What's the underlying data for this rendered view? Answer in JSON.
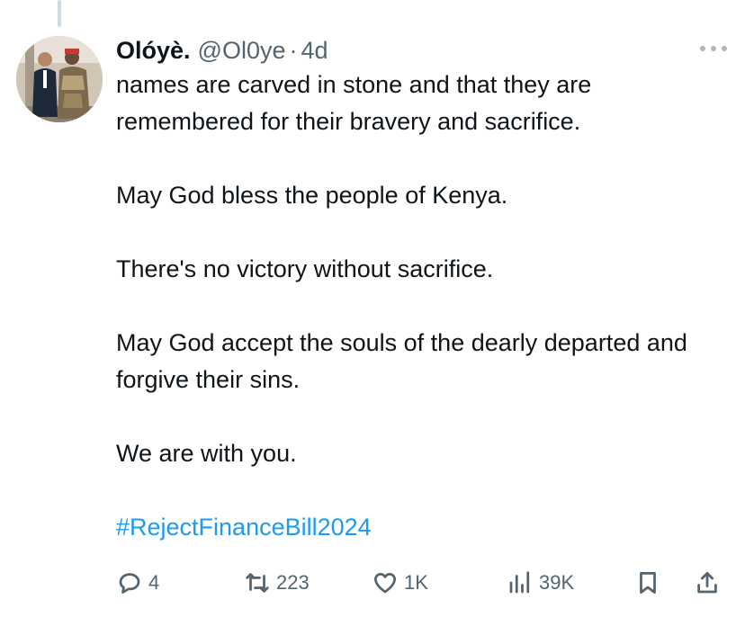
{
  "tweet": {
    "author_name": "Olóyè.",
    "handle": "@Ol0ye",
    "separator": "·",
    "time": "4d",
    "paragraphs": [
      "names are carved in stone and that they are remembered for their bravery and sacrifice.",
      "May God bless the people of Kenya.",
      "There's no victory without sacrifice.",
      "May God accept the souls of the dearly departed and forgive their sins.",
      "We are with you."
    ],
    "hashtag": "#RejectFinanceBill2024"
  },
  "actions": {
    "replies": "4",
    "reposts": "223",
    "likes": "1K",
    "views": "39K"
  },
  "icons": {
    "reply": "reply-icon",
    "repost": "repost-icon",
    "like": "heart-icon",
    "views": "views-icon",
    "bookmark": "bookmark-icon",
    "share": "share-icon",
    "more": "more-icon"
  },
  "colors": {
    "text": "#0f1419",
    "secondary": "#536471",
    "link": "#1d9bf0",
    "thread_line": "#cfd9de"
  }
}
